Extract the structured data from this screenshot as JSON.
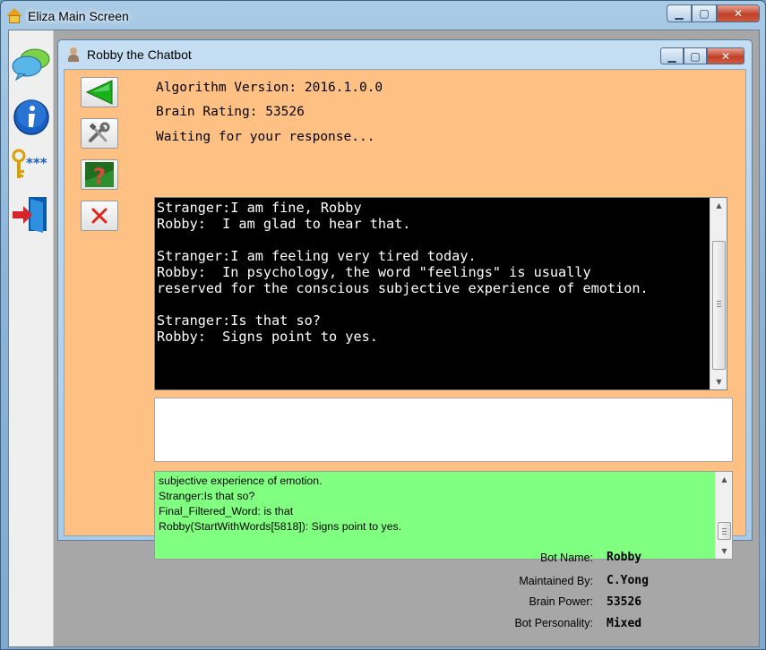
{
  "outer_window": {
    "title": "Eliza Main Screen",
    "min_label": "▁",
    "max_label": "▢",
    "close_label": "✕"
  },
  "toolbar": {
    "items": [
      {
        "icon": "chat-bubbles-icon"
      },
      {
        "icon": "info-icon"
      },
      {
        "icon": "key-password-icon",
        "label": "***"
      },
      {
        "icon": "exit-door-icon"
      }
    ]
  },
  "chat_window": {
    "title": "Robby the Chatbot",
    "min_label": "▁",
    "max_label": "▢",
    "close_label": "✕",
    "algorithm_version": "Algorithm Version: 2016.1.0.0",
    "brain_rating": "Brain Rating: 53526",
    "status": "Waiting for your response...",
    "side_buttons": [
      {
        "icon": "green-arrow-left-icon"
      },
      {
        "icon": "tools-icon"
      },
      {
        "icon": "question-mark-icon"
      },
      {
        "icon": "red-x-icon"
      }
    ],
    "transcript": "Stranger:I am fine, Robby\nRobby:  I am glad to hear that.\n\nStranger:I am feeling very tired today.\nRobby:  In psychology, the word \"feelings\" is usually\nreserved for the conscious subjective experience of emotion.\n\nStranger:Is that so?\nRobby:  Signs point to yes.",
    "input_value": "",
    "debug_log": [
      "subjective experience of emotion.",
      "Stranger:Is that so?",
      "Final_Filtered_Word: is that",
      "Robby(StartWithWords[5818]):  Signs point to yes."
    ]
  },
  "bot_info": {
    "bot_name_label": "Bot Name:",
    "bot_name": "Robby",
    "maintained_by_label": "Maintained By:",
    "maintained_by": "C.Yong",
    "brain_power_label": "Brain Power:",
    "brain_power": "53526",
    "personality_label": "Bot Personality:",
    "personality": "Mixed"
  },
  "colors": {
    "panel_bg": "#ffc183",
    "chat_bg": "#000000",
    "log_bg": "#80ff80",
    "client_bg": "#a7a7a7"
  }
}
